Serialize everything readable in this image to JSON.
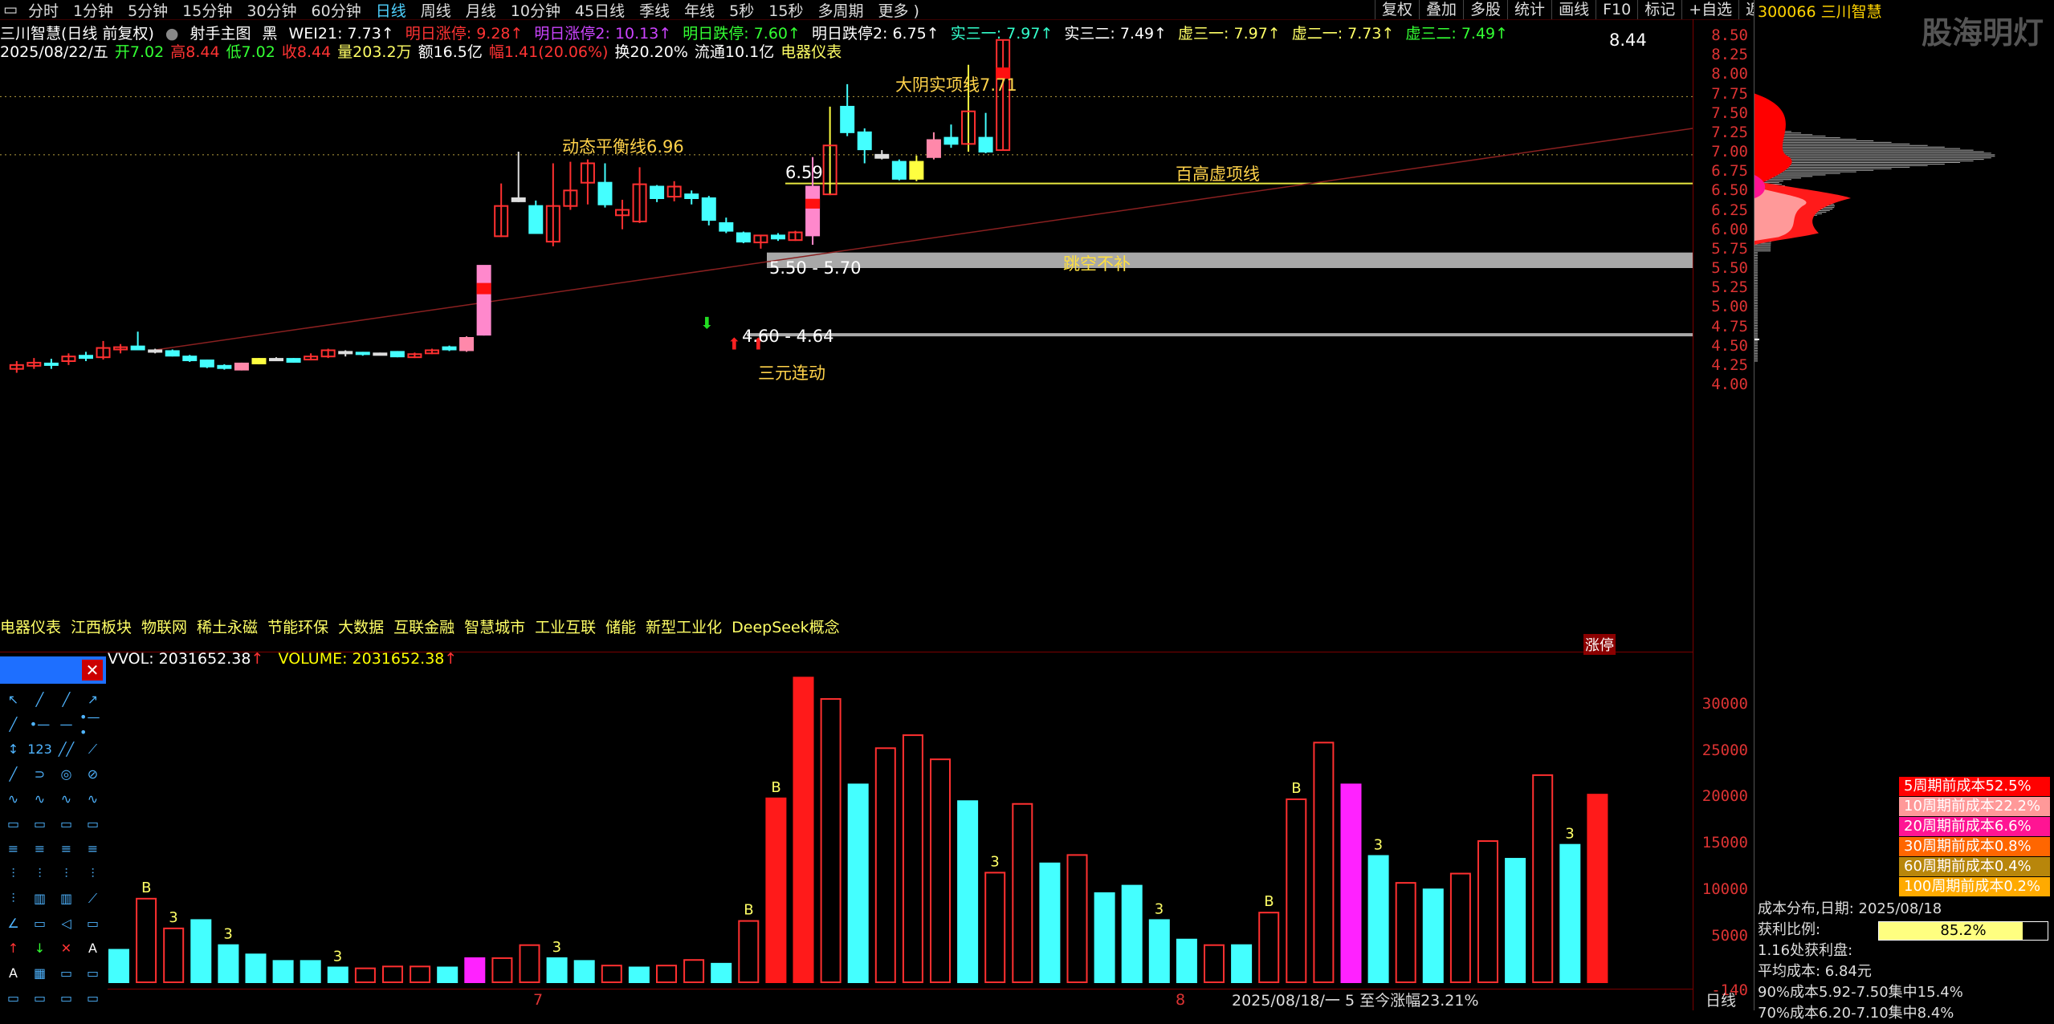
{
  "topbar": {
    "tabs": [
      "分时",
      "1分钟",
      "5分钟",
      "15分钟",
      "30分钟",
      "60分钟",
      "日线",
      "周线",
      "月线",
      "10分钟",
      "45日线",
      "季线",
      "年线",
      "5秒",
      "15秒",
      "多周期",
      "更多 )"
    ],
    "active": "日线"
  },
  "rightmenu": [
    "复权",
    "叠加",
    "多股",
    "统计",
    "画线",
    "F10",
    "标记",
    "+自选",
    "返回"
  ],
  "info": {
    "title": "三川智慧(日线 前复权)",
    "mode": "射手主图",
    "color_scheme": "黑",
    "items": [
      {
        "label": "WEI21: 7.73",
        "color": "#ffffff"
      },
      {
        "label": "明日涨停: 9.28",
        "color": "#ff3333"
      },
      {
        "label": "明日涨停2: 10.13",
        "color": "#cc44ff"
      },
      {
        "label": "明日跌停: 7.60",
        "color": "#33ff33"
      },
      {
        "label": "明日跌停2: 6.75",
        "color": "#ffffff"
      },
      {
        "label": "实三一: 7.97",
        "color": "#33ffcc"
      },
      {
        "label": "实三二: 7.49",
        "color": "#ffffff"
      },
      {
        "label": "虚三一: 7.97",
        "color": "#ffff66"
      },
      {
        "label": "虚二一: 7.73",
        "color": "#ffff66"
      },
      {
        "label": "虚三二: 7.49",
        "color": "#33ff33"
      }
    ],
    "line2": {
      "date": "2025/08/22/五",
      "open": "开7.02",
      "high": "高8.44",
      "low": "低7.02",
      "close": "收8.44",
      "volume": "量203.2万",
      "amount": "额16.5亿",
      "change": "幅1.41(20.06%)",
      "turnover": "换20.20%",
      "float": "流通10.1亿",
      "industry": "电器仪表"
    }
  },
  "price_axis": {
    "min": 4.0,
    "max": 6.5,
    "ticks": [
      "6.50",
      "6.25",
      "6.00",
      "5.75",
      "5.50",
      "5.25",
      "5.00",
      "4.75",
      "4.50",
      "4.25",
      "4.00"
    ],
    "ticks_top": [
      "8.50",
      "8.25",
      "8.00",
      "7.75",
      "7.50",
      "7.25",
      "7.00",
      "6.75"
    ]
  },
  "vol_axis": {
    "ticks": [
      "30000",
      "25000",
      "20000",
      "15000",
      "10000",
      "5000",
      "-140"
    ]
  },
  "annotations": {
    "dayin": "大阴实项线7.71",
    "dongtai": "动态平衡线6.96",
    "baigao": "百高虚项线",
    "tiaokong": "跳空不补",
    "sanyuan": "三元连动",
    "range1": "5.50 - 5.70",
    "range2": "4.60 - 4.64",
    "level659": "6.59",
    "peak": "8.44",
    "zhangting": "涨停"
  },
  "chips": [
    "电器仪表",
    "江西板块",
    "物联网",
    "稀土永磁",
    "节能环保",
    "大数据",
    "互联金融",
    "智慧城市",
    "工业互联",
    "储能",
    "新型工业化",
    "DeepSeek概念"
  ],
  "vol_header": {
    "vvol": "VVOL: 2031652.38",
    "volume": "VOLUME: 2031652.38"
  },
  "rightpanel": {
    "stock": "300066 三川智慧",
    "watermark": "股海明灯",
    "cost_legend": [
      {
        "label": "5周期前成本52.5%",
        "color": "#ff0000"
      },
      {
        "label": "10周期前成本22.2%",
        "color": "#ff9999"
      },
      {
        "label": "20周期前成本6.6%",
        "color": "#ff1493"
      },
      {
        "label": "30周期前成本0.8%",
        "color": "#ff6600"
      },
      {
        "label": "60周期前成本0.4%",
        "color": "#b8860b"
      },
      {
        "label": "100周期前成本0.2%",
        "color": "#ffaa00"
      }
    ],
    "cost_info": {
      "title": "成本分布,日期:  2025/08/18",
      "profit_label": "获利比例:",
      "profit_value": "85.2%",
      "profit_fraction": 0.852,
      "profit_zone": "1.16处获利盘:",
      "avg_cost": "平均成本:  6.84元",
      "c90": "90%成本5.92-7.50集中15.4%",
      "c70": "70%成本6.20-7.10集中8.4%"
    }
  },
  "bottom": {
    "range": "2025/08/18/一 5 至今涨幅23.21%",
    "axis": "日线",
    "month7": "7",
    "month8": "8"
  },
  "candles": [
    {
      "o": 4.2,
      "c": 4.25,
      "h": 4.3,
      "l": 4.15,
      "t": "up"
    },
    {
      "o": 4.24,
      "c": 4.28,
      "h": 4.34,
      "l": 4.2,
      "t": "up"
    },
    {
      "o": 4.25,
      "c": 4.27,
      "h": 4.33,
      "l": 4.2,
      "t": "dn"
    },
    {
      "o": 4.3,
      "c": 4.36,
      "h": 4.4,
      "l": 4.25,
      "t": "up"
    },
    {
      "o": 4.34,
      "c": 4.37,
      "h": 4.42,
      "l": 4.3,
      "t": "dn"
    },
    {
      "o": 4.35,
      "c": 4.47,
      "h": 4.56,
      "l": 4.32,
      "t": "up"
    },
    {
      "o": 4.45,
      "c": 4.48,
      "h": 4.52,
      "l": 4.4,
      "t": "up"
    },
    {
      "o": 4.49,
      "c": 4.45,
      "h": 4.68,
      "l": 4.44,
      "t": "dn"
    },
    {
      "o": 4.42,
      "c": 4.44,
      "h": 4.46,
      "l": 4.4,
      "t": "flat"
    },
    {
      "o": 4.43,
      "c": 4.37,
      "h": 4.45,
      "l": 4.36,
      "t": "dn"
    },
    {
      "o": 4.36,
      "c": 4.31,
      "h": 4.38,
      "l": 4.29,
      "t": "dn"
    },
    {
      "o": 4.31,
      "c": 4.23,
      "h": 4.32,
      "l": 4.21,
      "t": "dn"
    },
    {
      "o": 4.24,
      "c": 4.21,
      "h": 4.26,
      "l": 4.19,
      "t": "dn"
    },
    {
      "o": 4.19,
      "c": 4.27,
      "h": 4.28,
      "l": 4.18,
      "t": "pink"
    },
    {
      "o": 4.27,
      "c": 4.33,
      "h": 4.34,
      "l": 4.26,
      "t": "yellow"
    },
    {
      "o": 4.33,
      "c": 4.33,
      "h": 4.35,
      "l": 4.31,
      "t": "flat"
    },
    {
      "o": 4.29,
      "c": 4.33,
      "h": 4.34,
      "l": 4.28,
      "t": "dn"
    },
    {
      "o": 4.32,
      "c": 4.36,
      "h": 4.4,
      "l": 4.31,
      "t": "up"
    },
    {
      "o": 4.36,
      "c": 4.44,
      "h": 4.46,
      "l": 4.34,
      "t": "up"
    },
    {
      "o": 4.42,
      "c": 4.41,
      "h": 4.44,
      "l": 4.36,
      "t": "flat"
    },
    {
      "o": 4.41,
      "c": 4.39,
      "h": 4.42,
      "l": 4.37,
      "t": "dn"
    },
    {
      "o": 4.39,
      "c": 4.4,
      "h": 4.41,
      "l": 4.38,
      "t": "flat"
    },
    {
      "o": 4.42,
      "c": 4.36,
      "h": 4.43,
      "l": 4.35,
      "t": "dn"
    },
    {
      "o": 4.35,
      "c": 4.39,
      "h": 4.41,
      "l": 4.34,
      "t": "up"
    },
    {
      "o": 4.4,
      "c": 4.44,
      "h": 4.46,
      "l": 4.39,
      "t": "up"
    },
    {
      "o": 4.45,
      "c": 4.48,
      "h": 4.5,
      "l": 4.43,
      "t": "cyanup"
    },
    {
      "o": 4.44,
      "c": 4.6,
      "h": 4.62,
      "l": 4.42,
      "t": "pink"
    },
    {
      "o": 4.64,
      "c": 5.53,
      "h": 5.53,
      "l": 4.63,
      "t": "pinkbig"
    },
    {
      "o": 5.91,
      "c": 6.3,
      "h": 6.59,
      "l": 5.9,
      "t": "up"
    },
    {
      "o": 6.36,
      "c": 6.4,
      "h": 7.0,
      "l": 6.35,
      "t": "flat"
    },
    {
      "o": 6.3,
      "c": 5.95,
      "h": 6.37,
      "l": 5.94,
      "t": "dn"
    },
    {
      "o": 5.84,
      "c": 6.3,
      "h": 6.85,
      "l": 5.78,
      "t": "up"
    },
    {
      "o": 6.3,
      "c": 6.5,
      "h": 6.87,
      "l": 6.25,
      "t": "up"
    },
    {
      "o": 6.6,
      "c": 6.85,
      "h": 6.9,
      "l": 6.32,
      "t": "up"
    },
    {
      "o": 6.6,
      "c": 6.32,
      "h": 6.85,
      "l": 6.28,
      "t": "dn"
    },
    {
      "o": 6.25,
      "c": 6.18,
      "h": 6.38,
      "l": 6.0,
      "t": "up"
    },
    {
      "o": 6.1,
      "c": 6.58,
      "h": 6.8,
      "l": 6.08,
      "t": "up"
    },
    {
      "o": 6.55,
      "c": 6.4,
      "h": 6.57,
      "l": 6.35,
      "t": "dn"
    },
    {
      "o": 6.42,
      "c": 6.55,
      "h": 6.62,
      "l": 6.36,
      "t": "up"
    },
    {
      "o": 6.45,
      "c": 6.4,
      "h": 6.5,
      "l": 6.32,
      "t": "dn"
    },
    {
      "o": 6.4,
      "c": 6.12,
      "h": 6.43,
      "l": 6.05,
      "t": "dn"
    },
    {
      "o": 6.08,
      "c": 5.98,
      "h": 6.15,
      "l": 5.95,
      "t": "dn"
    },
    {
      "o": 5.95,
      "c": 5.84,
      "h": 5.97,
      "l": 5.82,
      "t": "dn"
    },
    {
      "o": 5.83,
      "c": 5.92,
      "h": 5.93,
      "l": 5.75,
      "t": "up"
    },
    {
      "o": 5.92,
      "c": 5.88,
      "h": 5.95,
      "l": 5.85,
      "t": "dn"
    },
    {
      "o": 5.86,
      "c": 5.96,
      "h": 5.98,
      "l": 5.85,
      "t": "up"
    },
    {
      "o": 5.92,
      "c": 6.55,
      "h": 6.93,
      "l": 5.8,
      "t": "pinkbig2"
    },
    {
      "o": 6.45,
      "c": 7.08,
      "h": 7.58,
      "l": 6.44,
      "t": "up"
    },
    {
      "o": 7.58,
      "c": 7.25,
      "h": 7.87,
      "l": 7.2,
      "t": "dn"
    },
    {
      "o": 7.25,
      "c": 7.03,
      "h": 7.3,
      "l": 6.85,
      "t": "dn"
    },
    {
      "o": 6.96,
      "c": 6.92,
      "h": 7.02,
      "l": 6.9,
      "t": "flat"
    },
    {
      "o": 6.87,
      "c": 6.65,
      "h": 6.9,
      "l": 6.63,
      "t": "dn"
    },
    {
      "o": 6.65,
      "c": 6.87,
      "h": 6.95,
      "l": 6.62,
      "t": "yellow"
    },
    {
      "o": 6.93,
      "c": 7.15,
      "h": 7.25,
      "l": 6.9,
      "t": "pink"
    },
    {
      "o": 7.18,
      "c": 7.1,
      "h": 7.35,
      "l": 7.05,
      "t": "dn"
    },
    {
      "o": 7.1,
      "c": 7.52,
      "h": 8.12,
      "l": 7.0,
      "t": "up"
    },
    {
      "o": 7.18,
      "c": 7.0,
      "h": 7.5,
      "l": 6.98,
      "t": "dn"
    },
    {
      "o": 7.02,
      "c": 8.44,
      "h": 8.44,
      "l": 7.02,
      "t": "up"
    }
  ],
  "volumes": [
    {
      "v": 3500,
      "t": "dn"
    },
    {
      "v": 9000,
      "t": "up",
      "lbl": "B"
    },
    {
      "v": 5800,
      "t": "up",
      "lbl": "3"
    },
    {
      "v": 6700,
      "t": "dn"
    },
    {
      "v": 4000,
      "t": "dn",
      "lbl": "3"
    },
    {
      "v": 3000,
      "t": "dn"
    },
    {
      "v": 2300,
      "t": "dn"
    },
    {
      "v": 2300,
      "t": "dn"
    },
    {
      "v": 1600,
      "t": "dn",
      "lbl": "3"
    },
    {
      "v": 1500,
      "t": "up"
    },
    {
      "v": 1700,
      "t": "up"
    },
    {
      "v": 1700,
      "t": "up"
    },
    {
      "v": 1600,
      "t": "dn"
    },
    {
      "v": 2600,
      "t": "mg"
    },
    {
      "v": 2600,
      "t": "up"
    },
    {
      "v": 4000,
      "t": "up"
    },
    {
      "v": 2600,
      "t": "dn",
      "lbl": "3"
    },
    {
      "v": 2300,
      "t": "dn"
    },
    {
      "v": 1800,
      "t": "up"
    },
    {
      "v": 1600,
      "t": "dn"
    },
    {
      "v": 1800,
      "t": "up"
    },
    {
      "v": 2400,
      "t": "up"
    },
    {
      "v": 2000,
      "t": "dn"
    },
    {
      "v": 6600,
      "t": "up",
      "lbl": "B"
    },
    {
      "v": 19800,
      "t": "rf",
      "lbl": "B"
    },
    {
      "v": 32800,
      "t": "rf"
    },
    {
      "v": 30500,
      "t": "up"
    },
    {
      "v": 21300,
      "t": "dn"
    },
    {
      "v": 25200,
      "t": "up"
    },
    {
      "v": 26600,
      "t": "up"
    },
    {
      "v": 24000,
      "t": "up"
    },
    {
      "v": 19500,
      "t": "dn"
    },
    {
      "v": 11800,
      "t": "up",
      "lbl": "3"
    },
    {
      "v": 19200,
      "t": "up"
    },
    {
      "v": 12800,
      "t": "dn"
    },
    {
      "v": 13700,
      "t": "up"
    },
    {
      "v": 9600,
      "t": "dn"
    },
    {
      "v": 10400,
      "t": "dn"
    },
    {
      "v": 6700,
      "t": "dn",
      "lbl": "3"
    },
    {
      "v": 4600,
      "t": "dn"
    },
    {
      "v": 4000,
      "t": "up"
    },
    {
      "v": 4000,
      "t": "dn"
    },
    {
      "v": 7500,
      "t": "up",
      "lbl": "B"
    },
    {
      "v": 19700,
      "t": "up",
      "lbl": "B"
    },
    {
      "v": 25800,
      "t": "up"
    },
    {
      "v": 21300,
      "t": "mg"
    },
    {
      "v": 13600,
      "t": "dn",
      "lbl": "3"
    },
    {
      "v": 10700,
      "t": "up"
    },
    {
      "v": 10000,
      "t": "dn"
    },
    {
      "v": 11700,
      "t": "up"
    },
    {
      "v": 15200,
      "t": "up"
    },
    {
      "v": 13300,
      "t": "dn"
    },
    {
      "v": 22300,
      "t": "up"
    },
    {
      "v": 14800,
      "t": "dn",
      "lbl": "3"
    },
    {
      "v": 20200,
      "t": "rf"
    }
  ]
}
